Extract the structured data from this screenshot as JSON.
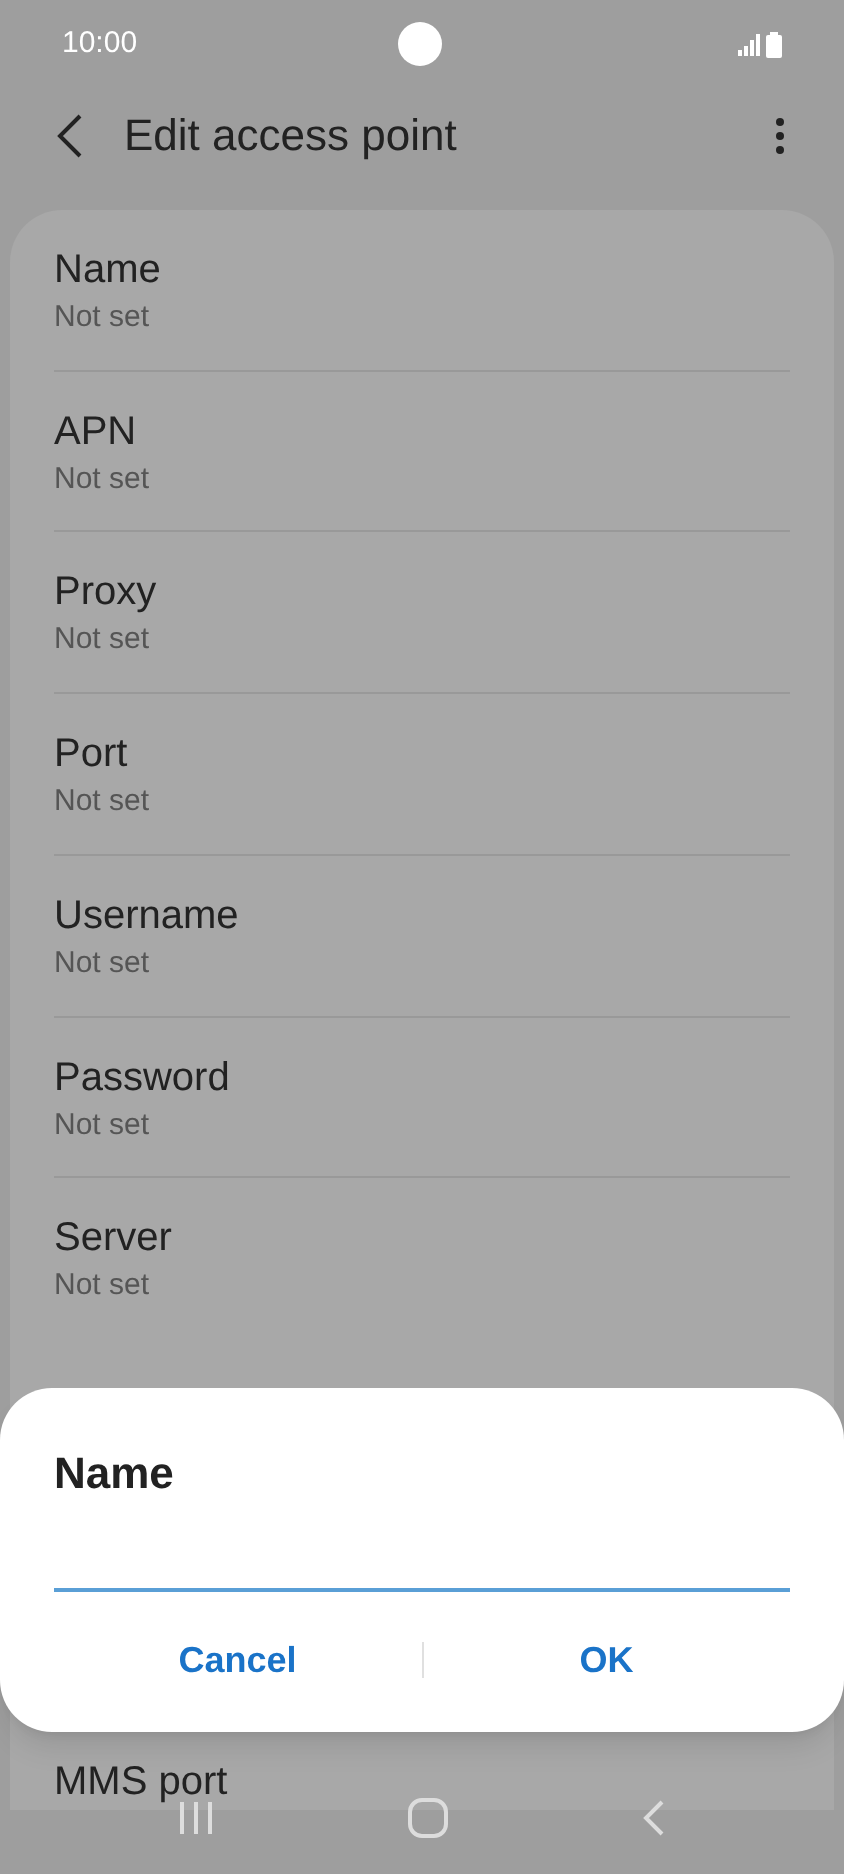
{
  "status_bar": {
    "time": "10:00"
  },
  "header": {
    "title": "Edit access point"
  },
  "settings": [
    {
      "label": "Name",
      "value": "Not set"
    },
    {
      "label": "APN",
      "value": "Not set"
    },
    {
      "label": "Proxy",
      "value": "Not set"
    },
    {
      "label": "Port",
      "value": "Not set"
    },
    {
      "label": "Username",
      "value": "Not set"
    },
    {
      "label": "Password",
      "value": "Not set"
    },
    {
      "label": "Server",
      "value": "Not set"
    }
  ],
  "partly_hidden_setting": {
    "label": "MMS port"
  },
  "dialog": {
    "title": "Name",
    "buttons": [
      "Cancel",
      "OK"
    ]
  }
}
